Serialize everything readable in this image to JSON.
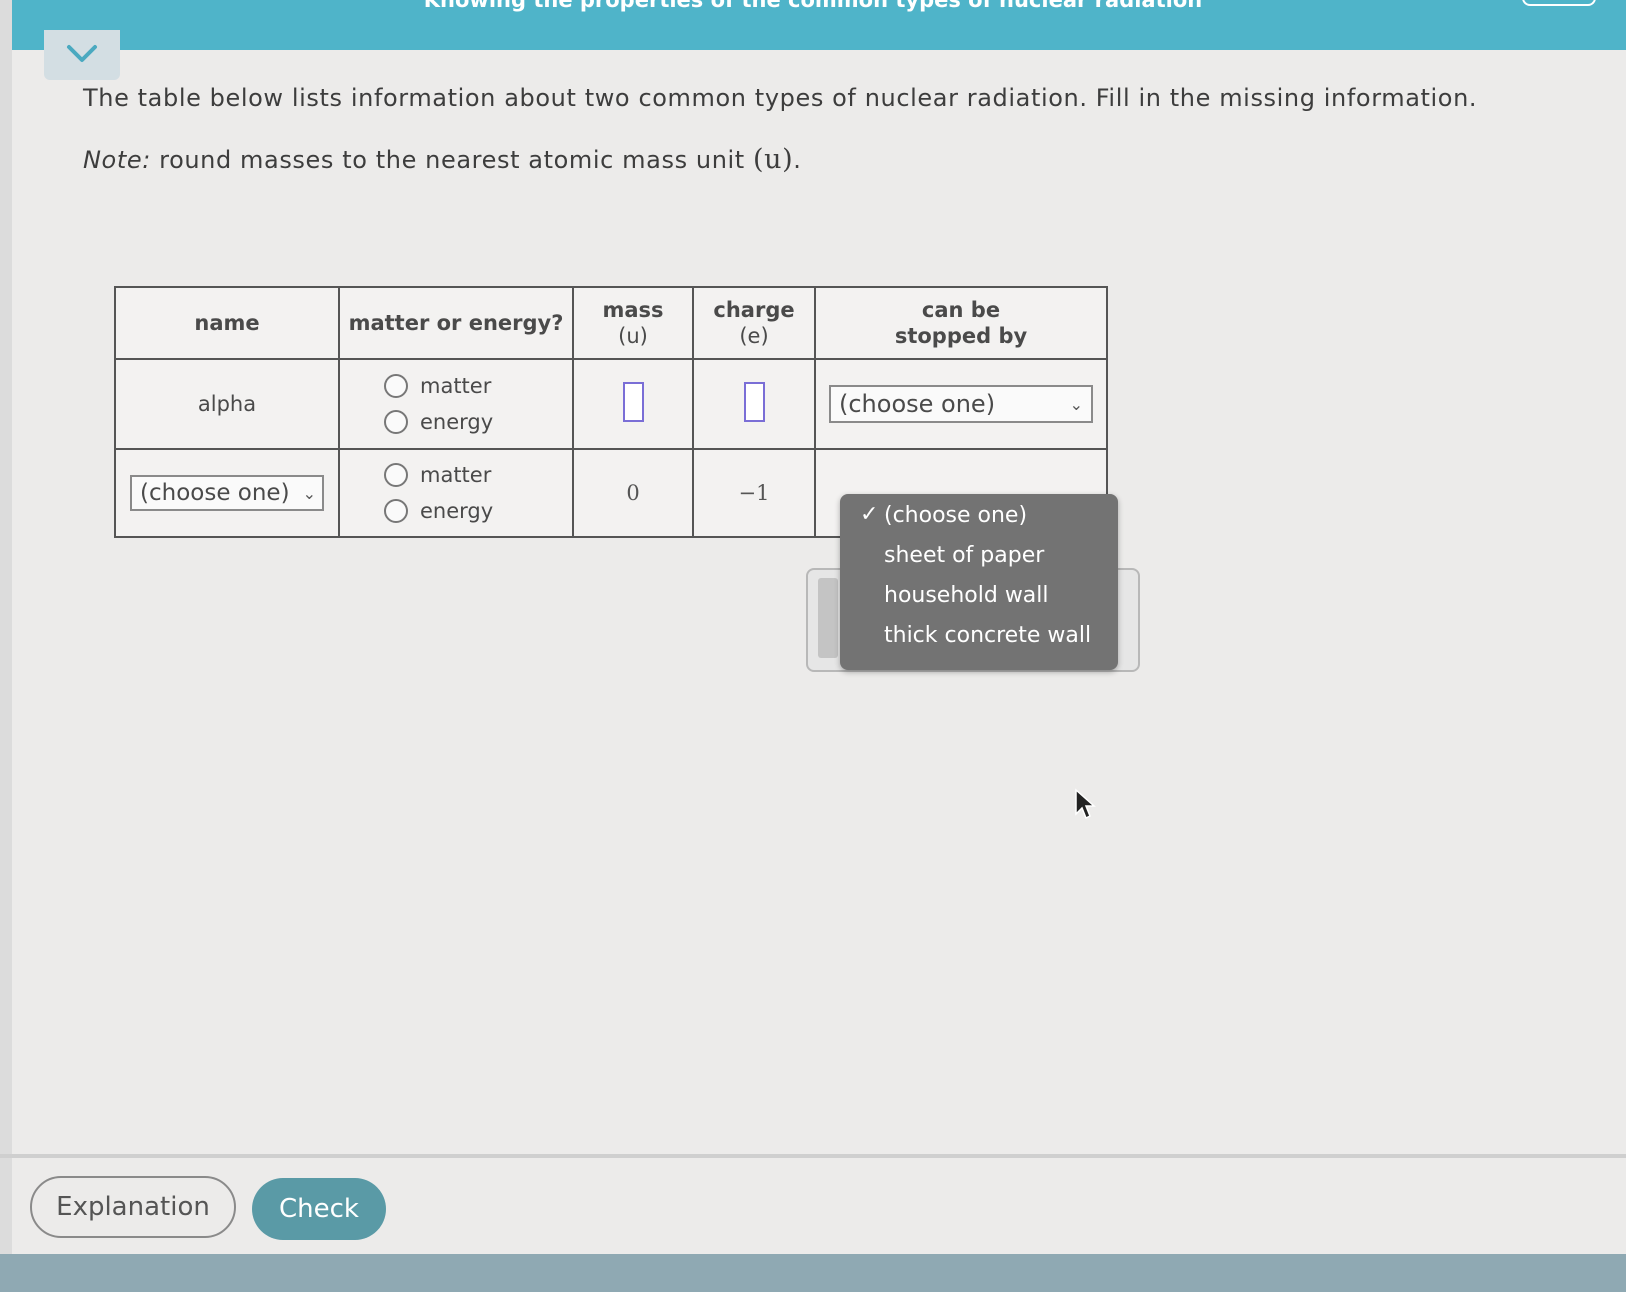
{
  "header": {
    "title": "Knowing the properties of the common types of nuclear radiation",
    "collapse_icon": "chevron-down-icon"
  },
  "problem": {
    "text": "The table below lists information about two common types of nuclear radiation. Fill in the missing information.",
    "note_label": "Note:",
    "note_text": " round masses to the nearest atomic mass unit ",
    "note_unit": "(u)",
    "note_end": "."
  },
  "table": {
    "headers": {
      "name": "name",
      "matter_energy": "matter or energy?",
      "mass": "mass",
      "mass_unit": "(u)",
      "charge": "charge",
      "charge_unit": "(e)",
      "stopped_line1": "can be",
      "stopped_line2": "stopped by"
    },
    "rows": [
      {
        "name": "alpha",
        "matter_label": "matter",
        "energy_label": "energy",
        "mass": "",
        "charge": "",
        "stopped_by": "(choose one)"
      },
      {
        "name_select": "(choose one)",
        "matter_label": "matter",
        "energy_label": "energy",
        "mass": "0",
        "charge": "−1"
      }
    ]
  },
  "dropdown": {
    "options": [
      "(choose one)",
      "sheet of paper",
      "household wall",
      "thick concrete wall"
    ],
    "selected": "(choose one)"
  },
  "buttons": {
    "explanation": "Explanation",
    "check": "Check"
  },
  "colors": {
    "topbar": "#4fb4c9",
    "check_button": "#5a9aa6",
    "answer_box_border": "#7a6ed6",
    "dropdown_bg": "#737373"
  }
}
